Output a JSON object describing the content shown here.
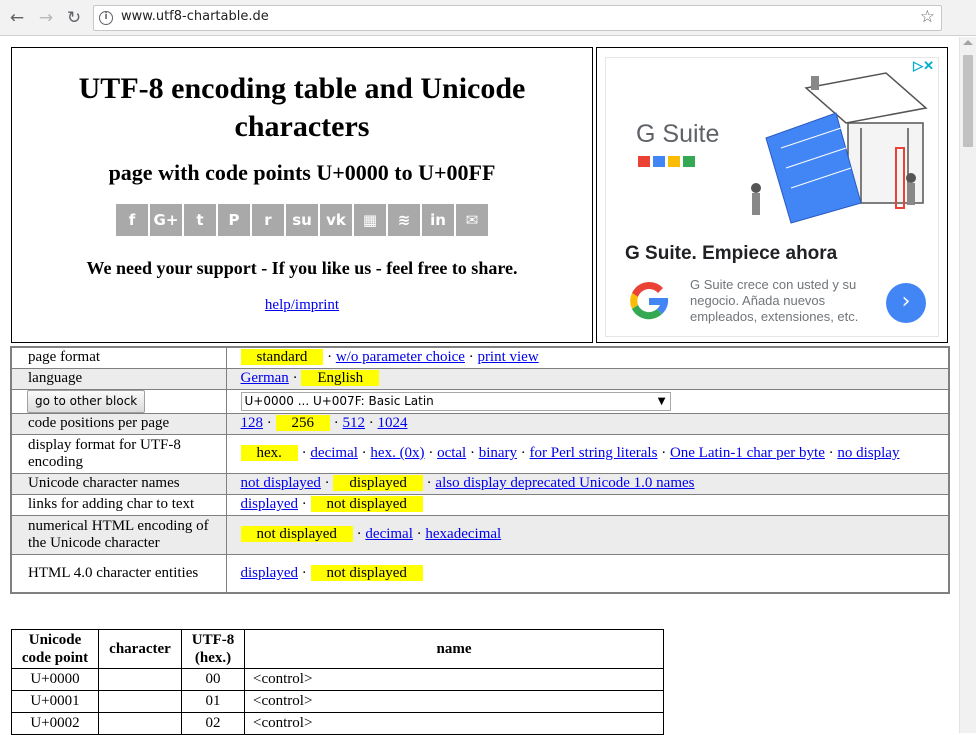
{
  "browser": {
    "url": "www.utf8-chartable.de"
  },
  "header": {
    "title": "UTF-8 encoding table and Unicode characters",
    "subtitle": "page with code points U+0000 to U+00FF",
    "support_text": "We need your support - If you like us - feel free to share.",
    "help_link": "help/imprint",
    "share_icons": [
      {
        "icon": "facebook-icon",
        "glyph": "f"
      },
      {
        "icon": "google-plus-icon",
        "glyph": "G+"
      },
      {
        "icon": "twitter-icon",
        "glyph": "t"
      },
      {
        "icon": "pinterest-icon",
        "glyph": "P"
      },
      {
        "icon": "reddit-icon",
        "glyph": "r"
      },
      {
        "icon": "stumbleupon-icon",
        "glyph": "su"
      },
      {
        "icon": "vk-icon",
        "glyph": "vk"
      },
      {
        "icon": "delicious-icon",
        "glyph": "▦"
      },
      {
        "icon": "buffer-icon",
        "glyph": "≋"
      },
      {
        "icon": "linkedin-icon",
        "glyph": "in"
      },
      {
        "icon": "email-icon",
        "glyph": "✉"
      }
    ]
  },
  "ad": {
    "brand": "G Suite",
    "headline": "G Suite. Empiece ahora",
    "body": "G Suite crece con usted y su negocio. Añada nuevos empleados, extensiones, etc.",
    "arrow": "›",
    "adchoices": "▷✕",
    "colors": {
      "blue": "#4285f4",
      "red": "#ea4335",
      "yellow": "#fbbc05",
      "green": "#34a853"
    }
  },
  "settings": {
    "page_format": {
      "label": "page format",
      "selected": "standard",
      "links": [
        "w/o parameter choice",
        "print view"
      ]
    },
    "language": {
      "label": "language",
      "link": "German",
      "selected": "English"
    },
    "block": {
      "button": "go to other block",
      "select_value": "U+0000 ... U+007F: Basic Latin"
    },
    "positions": {
      "label": "code positions per page",
      "opt1": "128",
      "selected": "256",
      "opt3": "512",
      "opt4": "1024"
    },
    "display_format": {
      "label": "display format for UTF-8 encoding",
      "selected": "hex.",
      "opt1": "decimal",
      "opt2": "hex. (0x)",
      "opt3": "octal",
      "opt4": "binary",
      "opt5": "for Perl string literals",
      "opt6": "One Latin-1 char per byte",
      "opt7": "no display"
    },
    "char_names": {
      "label": "Unicode character names",
      "link1": "not displayed",
      "selected": "displayed",
      "link2": "also display deprecated Unicode 1.0 names"
    },
    "links_adding": {
      "label": "links for adding char to text",
      "link": "displayed",
      "selected": "not displayed"
    },
    "numerical_html": {
      "label": "numerical HTML encoding of the Unicode character",
      "selected": "not displayed",
      "link1": "decimal",
      "link2": "hexadecimal"
    },
    "html_entities": {
      "label": "HTML 4.0 character entities",
      "link": "displayed",
      "selected": "not displayed"
    },
    "separator": "·",
    "highlight_color": "#ffff00"
  },
  "code_table": {
    "headers": {
      "code_point": "Unicode code point",
      "character": "character",
      "utf8": "UTF-8 (hex.)",
      "name": "name"
    },
    "rows": [
      {
        "cp": "U+0000",
        "char": "",
        "hex": "00",
        "name": "<control>"
      },
      {
        "cp": "U+0001",
        "char": "",
        "hex": "01",
        "name": "<control>"
      },
      {
        "cp": "U+0002",
        "char": "",
        "hex": "02",
        "name": "<control>"
      }
    ]
  }
}
